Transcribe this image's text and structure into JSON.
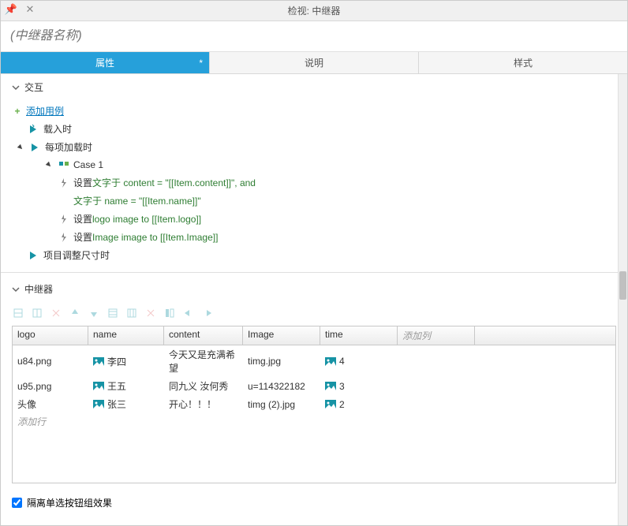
{
  "window": {
    "title": "检视: 中继器"
  },
  "nameField": {
    "placeholder": "(中继器名称)"
  },
  "tabs": {
    "properties": "属性",
    "notes": "说明",
    "style": "样式"
  },
  "sections": {
    "interactions": "交互",
    "addCase": "添加用例",
    "onLoad": "载入时",
    "onItemLoad": "每项加载时",
    "case1": "Case 1",
    "action1_prefix": "设置 ",
    "action1_green": "文字于 content = \"[[Item.content]]\", and",
    "action1_line2": "文字于 name = \"[[Item.name]]\"",
    "action2_prefix": "设置 ",
    "action2_green": "logo image to [[Item.logo]]",
    "action3_prefix": "设置 ",
    "action3_green": "Image image to [[Item.Image]]",
    "onResize": "项目调整尺寸时",
    "repeater": "中继器"
  },
  "table": {
    "columns": {
      "logo": "logo",
      "name": "name",
      "content": "content",
      "image": "Image",
      "time": "time",
      "add": "添加列"
    },
    "rows": [
      {
        "logo": "u84.png",
        "name": "李四",
        "content": "今天又是充满希望",
        "image": "timg.jpg",
        "time": "4"
      },
      {
        "logo": "u95.png",
        "name": "王五",
        "content": "同九义 汝何秀",
        "image": "u=114322182",
        "time": "3"
      },
      {
        "logo": "头像",
        "name": "张三",
        "content": "开心！！！",
        "image": "timg (2).jpg",
        "time": "2"
      }
    ],
    "addRow": "添加行"
  },
  "isolate": "隔离单选按钮组效果",
  "colors": {
    "accent": "#26a0da",
    "green": "#2e7d32",
    "iconTeal": "#1693a5"
  }
}
